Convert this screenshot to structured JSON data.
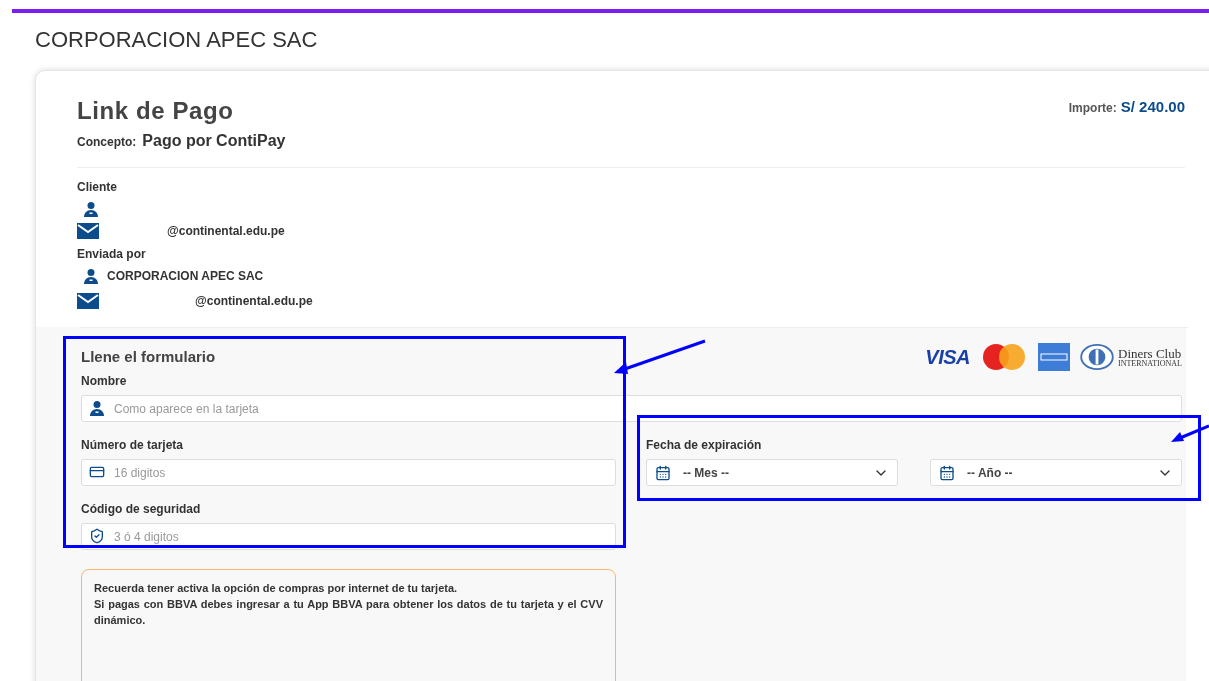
{
  "header": {
    "company": "CORPORACION APEC SAC"
  },
  "payment": {
    "title": "Link de Pago",
    "concept_label": "Concepto:",
    "concept": "Pago por ContiPay",
    "amount_label": "Importe:",
    "amount": "S/ 240.00"
  },
  "client": {
    "label": "Cliente",
    "email": "@continental.edu.pe"
  },
  "sender": {
    "label": "Enviada por",
    "name": "CORPORACION APEC SAC",
    "email": "@continental.edu.pe"
  },
  "form": {
    "title": "Llene el formulario",
    "card_brands": [
      {
        "kind": "visa",
        "text": "VISA"
      },
      {
        "kind": "mastercard"
      },
      {
        "kind": "amex"
      },
      {
        "kind": "diners",
        "text": "Diners Club",
        "subtext": "INTERNATIONAL"
      }
    ],
    "name_field": {
      "label": "Nombre",
      "placeholder": "Como aparece en la tarjeta",
      "kind": "person"
    },
    "fields": [
      {
        "label": "Número de tarjeta",
        "placeholder": "16 digitos",
        "kind": "card"
      },
      {
        "label": "Código de seguridad",
        "placeholder": "3 ó 4 digitos",
        "kind": "shield"
      }
    ],
    "expiry": {
      "label": "Fecha de expiración",
      "selects": [
        {
          "value": "-- Mes --"
        },
        {
          "value": "-- Año --"
        }
      ]
    }
  },
  "notice": {
    "paragraphs": [
      "Recuerda tener activa la opción de compras por internet de tu tarjeta.",
      "Si pagas con BBVA debes ingresar a tu App BBVA para obtener los datos de tu tarjeta y el CVV dinámico."
    ]
  }
}
